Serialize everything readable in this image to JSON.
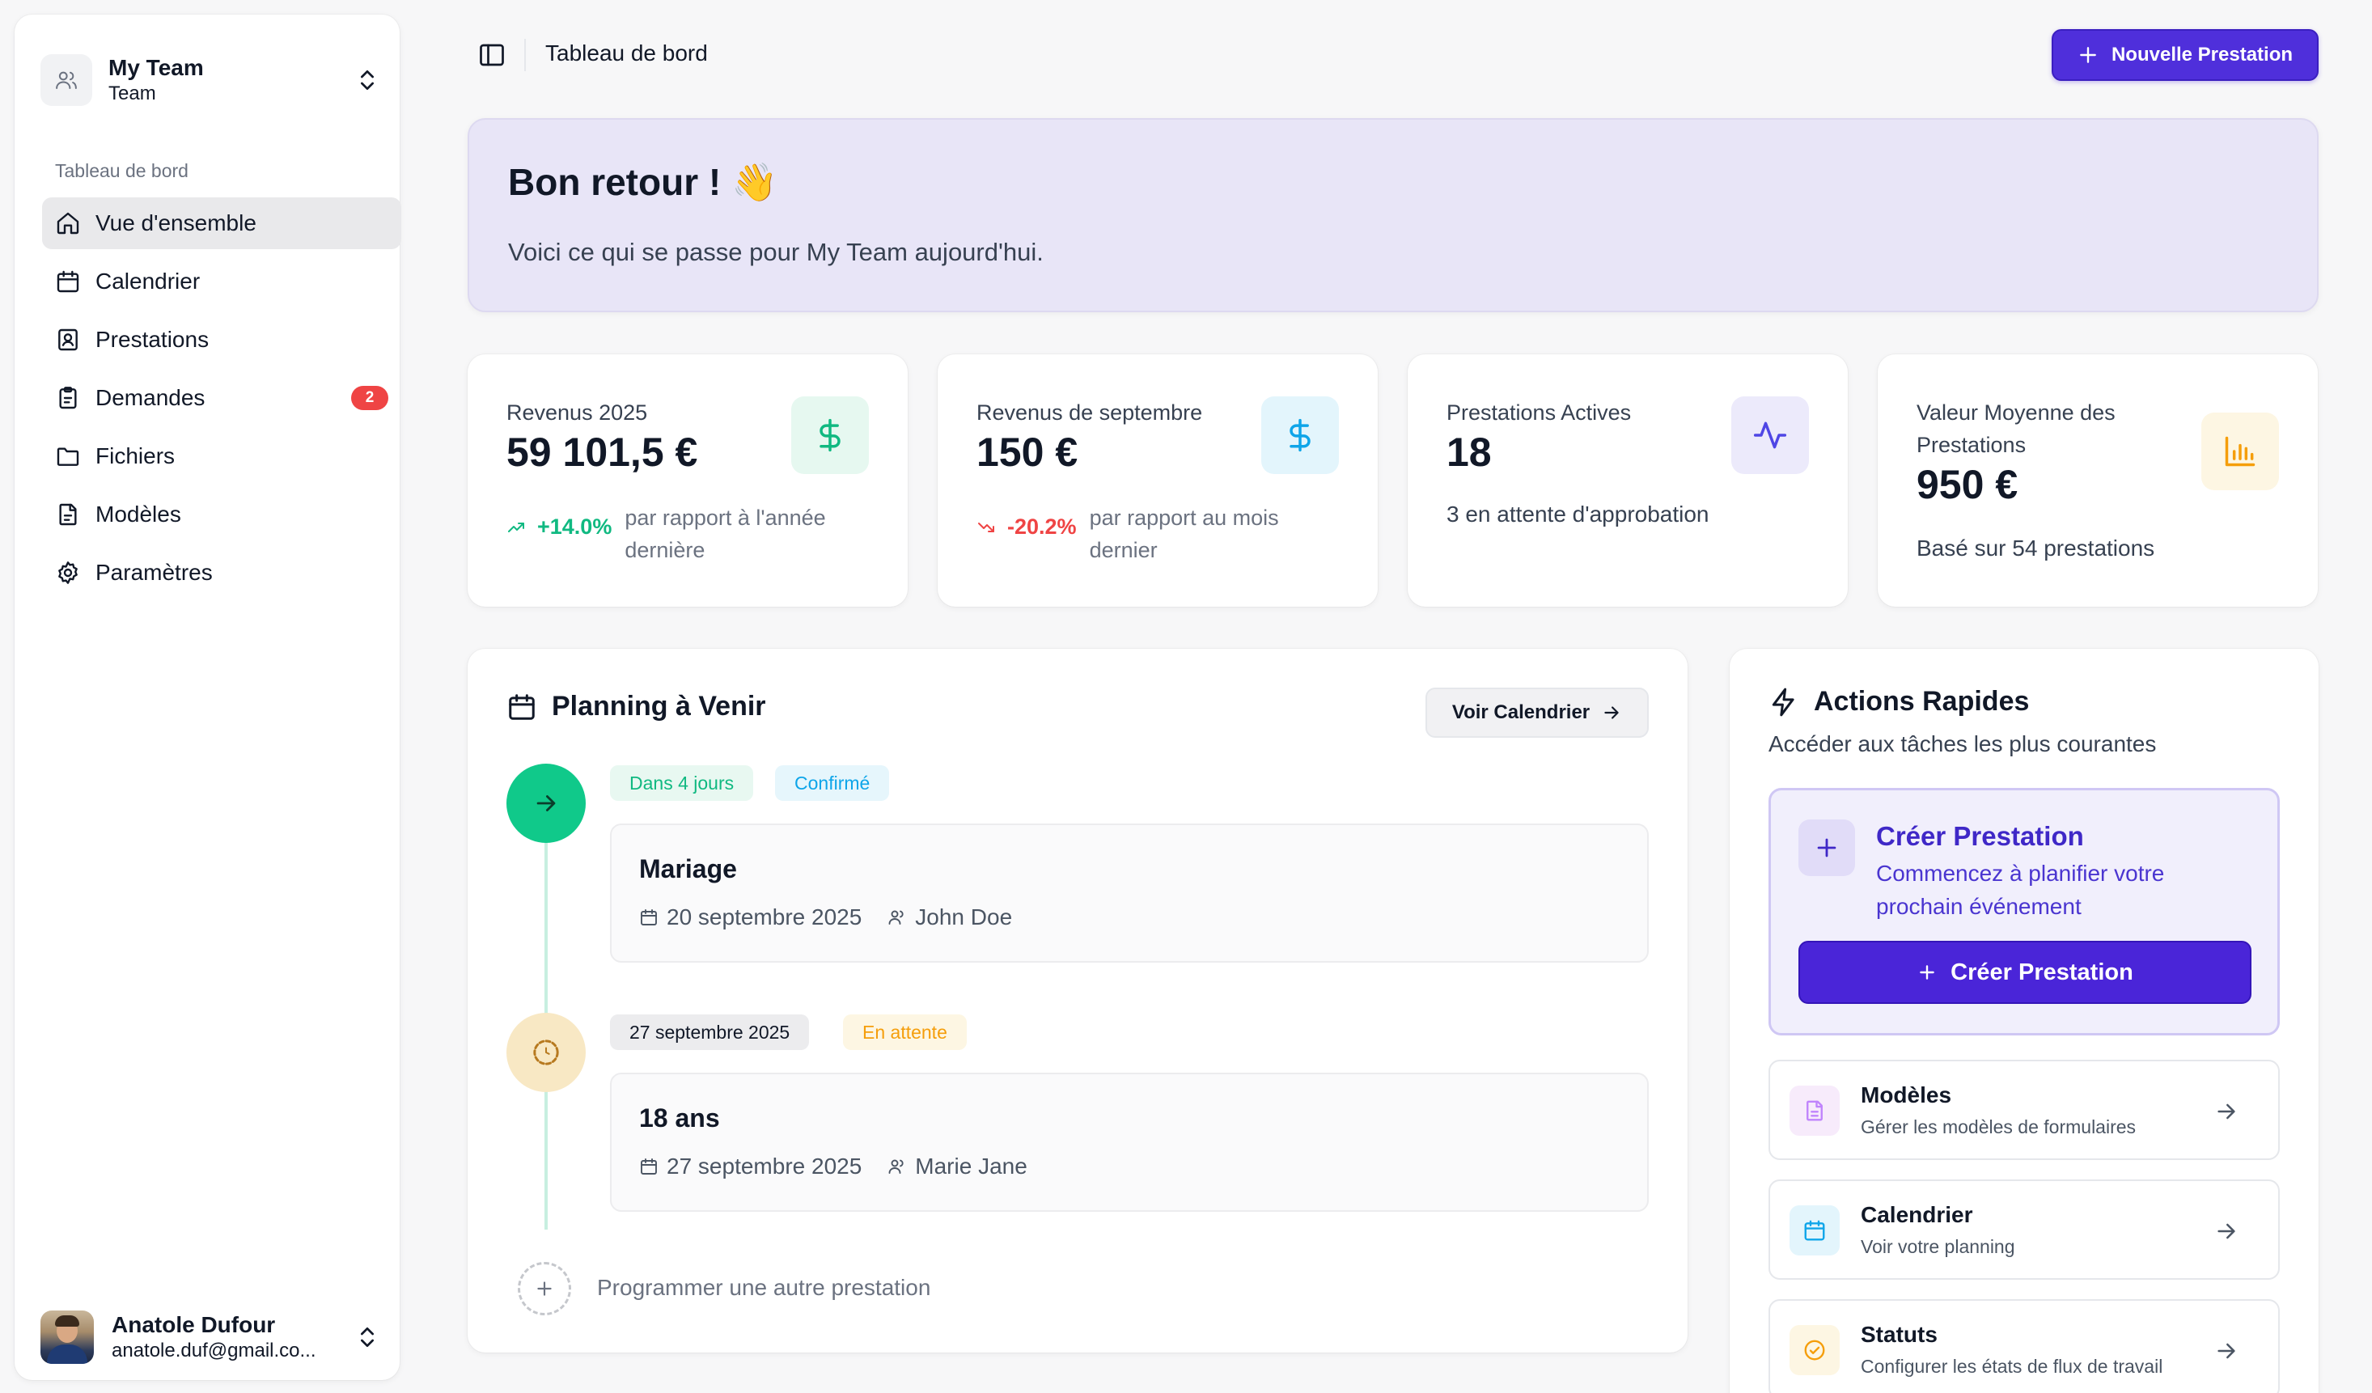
{
  "sidebar": {
    "team_name": "My Team",
    "team_sub": "Team",
    "section_label": "Tableau de bord",
    "items": [
      {
        "label": "Vue d'ensemble",
        "icon": "home-icon",
        "active": true
      },
      {
        "label": "Calendrier",
        "icon": "calendar-icon"
      },
      {
        "label": "Prestations",
        "icon": "contact-book-icon"
      },
      {
        "label": "Demandes",
        "icon": "clipboard-icon",
        "badge": "2"
      },
      {
        "label": "Fichiers",
        "icon": "folder-icon"
      },
      {
        "label": "Modèles",
        "icon": "file-template-icon"
      },
      {
        "label": "Paramètres",
        "icon": "gear-icon"
      }
    ],
    "user": {
      "name": "Anatole Dufour",
      "email": "anatole.duf@gmail.co..."
    }
  },
  "topbar": {
    "title": "Tableau de bord",
    "new_button": "Nouvelle Prestation"
  },
  "welcome": {
    "title": "Bon retour ! 👋",
    "subtitle": "Voici ce qui se passe pour My Team aujourd'hui."
  },
  "stats": [
    {
      "label": "Revenus 2025",
      "value": "59 101,5 €",
      "trend": "+14.0%",
      "trend_dir": "up",
      "trend_text": "par rapport à l'année dernière",
      "icon": "dollar-icon",
      "accent": "#10b981"
    },
    {
      "label": "Revenus de septembre",
      "value": "150 €",
      "trend": "-20.2%",
      "trend_dir": "down",
      "trend_text": "par rapport au mois dernier",
      "icon": "dollar-icon",
      "accent": "#0ea5e9"
    },
    {
      "label": "Prestations Actives",
      "value": "18",
      "note": "3 en attente d'approbation",
      "icon": "activity-icon",
      "accent": "#4f46e5"
    },
    {
      "label": "Valeur Moyenne des Prestations",
      "value": "950 €",
      "note": "Basé sur 54 prestations",
      "icon": "bar-chart-icon",
      "accent": "#f59e0b"
    }
  ],
  "planning": {
    "title": "Planning à Venir",
    "view_button": "Voir Calendrier",
    "events": [
      {
        "chip1": "Dans 4 jours",
        "chip2": "Confirmé",
        "title": "Mariage",
        "date": "20 septembre 2025",
        "person": "John Doe",
        "status_icon": "arrow-right-icon"
      },
      {
        "chip1": "27 septembre 2025",
        "chip2": "En attente",
        "title": "18 ans",
        "date": "27 septembre 2025",
        "person": "Marie Jane",
        "status_icon": "history-icon"
      }
    ],
    "add_text": "Programmer une autre prestation"
  },
  "actions": {
    "title": "Actions Rapides",
    "subtitle": "Accéder aux tâches les plus courantes",
    "create": {
      "title": "Créer Prestation",
      "subtitle": "Commencez à planifier votre prochain événement",
      "button": "Créer Prestation"
    },
    "items": [
      {
        "title": "Modèles",
        "subtitle": "Gérer les modèles de formulaires",
        "icon": "file-icon"
      },
      {
        "title": "Calendrier",
        "subtitle": "Voir votre planning",
        "icon": "calendar-icon"
      },
      {
        "title": "Statuts",
        "subtitle": "Configurer les états de flux de travail",
        "icon": "check-circle-icon"
      }
    ]
  },
  "colors": {
    "brand": "#4f2fdb",
    "success": "#10b981",
    "danger": "#ef4444",
    "warning": "#f59e0b"
  }
}
